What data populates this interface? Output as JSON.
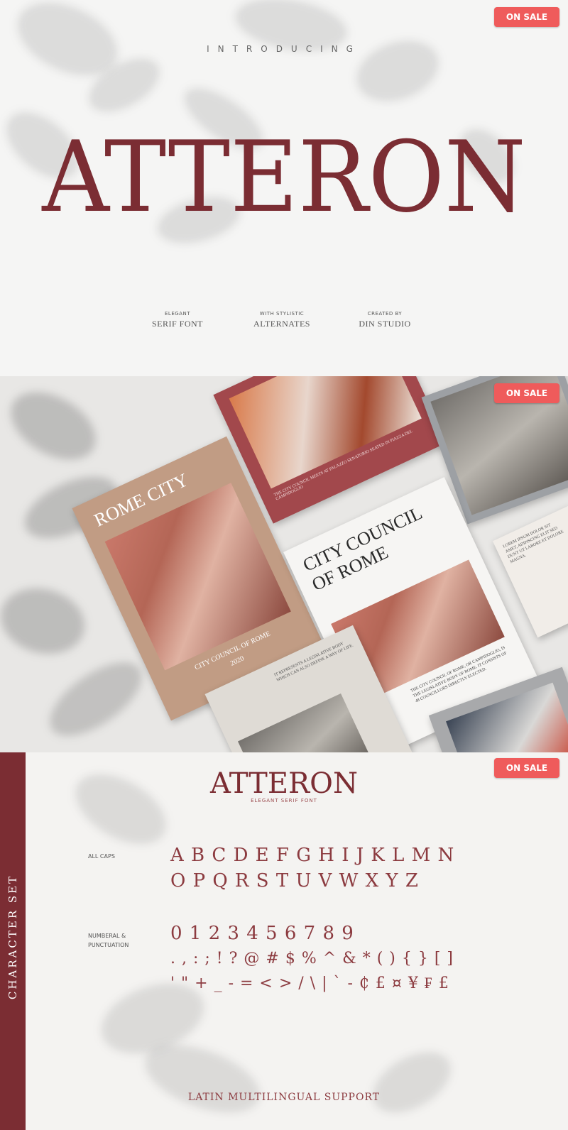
{
  "badge": {
    "label": "ON SALE"
  },
  "section1": {
    "introducing": "INTRODUCING",
    "title": "ATTERON",
    "features": [
      {
        "small": "ELEGANT",
        "big": "SERIF FONT"
      },
      {
        "small": "WITH STYLISTIC",
        "big": "ALTERNATES"
      },
      {
        "small": "CREATED BY",
        "big": "DIN STUDIO"
      }
    ]
  },
  "section2": {
    "card_rome_title": "ROME CITY",
    "card_rome_caption": "CITY COUNCIL OF ROME",
    "card_rome_year": "2020",
    "card_council_title": "CITY COUNCIL OF ROME",
    "card_council_body": "THE CITY COUNCIL OF ROME, OR CAMPIDOGLIO, IS THE LEGISLATIVE BODY OF ROME. IT CONSISTS OF 48 COUNCILLORS DIRECTLY ELECTED.",
    "card_tea_caption": "THE CITY COUNCIL MEETS AT PALAZZO SENATORIO SEATED IN PIAZZA DEL CAMPIDOGLIO",
    "card_bottom_body": "IT REPRESENTS A LEGISLATIVE BODY WHICH CAN ALSO DEFINE A WAY OF LIFE.",
    "card_side_body": "LOREM IPSUM DOLOR SIT AMET, ADIPISCING ELIT SED DUNT UT LABORE ET DOLORE MAGNA."
  },
  "section3": {
    "sidebar_label": "CHARACTER SET",
    "logo": "ATTERON",
    "logo_sub": "ELEGANT SERIF FONT",
    "caps_label": "ALL CAPS",
    "caps_row1": "A B C D E F G H I J K L M N",
    "caps_row2": "O P Q R S T U V W X Y Z",
    "num_label": "NUMBERAL &\nPUNCTUATION",
    "num_row": "0 1 2 3 4 5 6 7 8 9",
    "punct_row1": ". , : ; ! ? @ # $ % ^ & * ( ) { } [ ]",
    "punct_row2": "' \" + _ - = < > / \\ | ` - ₵ £ ¤ ¥ ₣ £",
    "footer": "LATIN MULTILINGUAL SUPPORT"
  },
  "colors": {
    "accent": "#7b2d33",
    "badge": "#ef5b5b",
    "background": "#f4f3f1"
  }
}
